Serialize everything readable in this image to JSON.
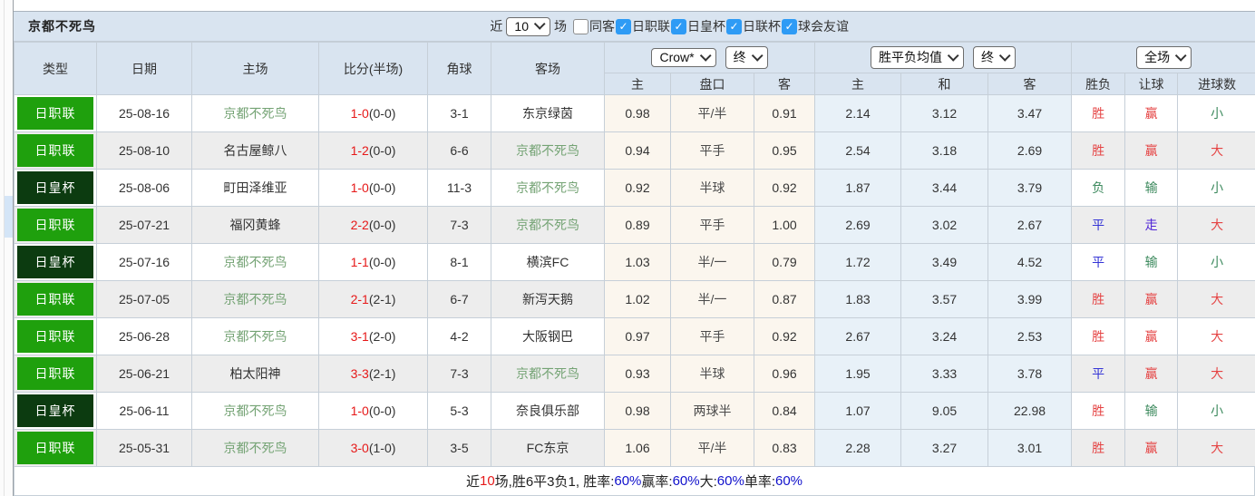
{
  "topbar": {
    "title": "京都不死鸟",
    "recent_label": "近",
    "recent_value": "10",
    "matches_label": "场",
    "filters": [
      {
        "label": "同客",
        "checked": false
      },
      {
        "label": "日职联",
        "checked": true
      },
      {
        "label": "日皇杯",
        "checked": true
      },
      {
        "label": "日联杯",
        "checked": true
      },
      {
        "label": "球会友谊",
        "checked": true
      }
    ]
  },
  "table": {
    "main_headers": [
      "类型",
      "日期",
      "主场",
      "比分(半场)",
      "角球",
      "客场"
    ],
    "odds_group": {
      "company_select": "Crow*",
      "time_select": "终"
    },
    "mean_group": {
      "label_select": "胜平负均值",
      "time_select": "终"
    },
    "scope_group": {
      "scope_select": "全场"
    },
    "sub_headers": [
      "主",
      "盘口",
      "客",
      "主",
      "和",
      "客",
      "胜负",
      "让球",
      "进球数"
    ],
    "rows": [
      {
        "type": "日职联",
        "is_cup": false,
        "date": "25-08-16",
        "home": "京都不死鸟",
        "home_is_focus": true,
        "score_full": "1-0",
        "score_half": "(0-0)",
        "corners": "3-1",
        "away": "东京绿茵",
        "away_is_focus": false,
        "crow_home": "0.98",
        "handicap": "平/半",
        "crow_away": "0.91",
        "mean_home": "2.14",
        "mean_draw": "3.12",
        "mean_away": "3.47",
        "result": "胜",
        "result_color": "red",
        "handicap_result": "赢",
        "handicap_result_color": "red",
        "goals_result": "小",
        "goals_result_color": "green"
      },
      {
        "type": "日职联",
        "is_cup": false,
        "date": "25-08-10",
        "home": "名古屋鲸八",
        "home_is_focus": false,
        "score_full": "1-2",
        "score_half": "(0-0)",
        "corners": "6-6",
        "away": "京都不死鸟",
        "away_is_focus": true,
        "crow_home": "0.94",
        "handicap": "平手",
        "crow_away": "0.95",
        "mean_home": "2.54",
        "mean_draw": "3.18",
        "mean_away": "2.69",
        "result": "胜",
        "result_color": "red",
        "handicap_result": "赢",
        "handicap_result_color": "red",
        "goals_result": "大",
        "goals_result_color": "red"
      },
      {
        "type": "日皇杯",
        "is_cup": true,
        "date": "25-08-06",
        "home": "町田泽维亚",
        "home_is_focus": false,
        "score_full": "1-0",
        "score_half": "(0-0)",
        "corners": "11-3",
        "away": "京都不死鸟",
        "away_is_focus": true,
        "crow_home": "0.92",
        "handicap": "半球",
        "crow_away": "0.92",
        "mean_home": "1.87",
        "mean_draw": "3.44",
        "mean_away": "3.79",
        "result": "负",
        "result_color": "green",
        "handicap_result": "输",
        "handicap_result_color": "green",
        "goals_result": "小",
        "goals_result_color": "green"
      },
      {
        "type": "日职联",
        "is_cup": false,
        "date": "25-07-21",
        "home": "福冈黄蜂",
        "home_is_focus": false,
        "score_full": "2-2",
        "score_half": "(0-0)",
        "corners": "7-3",
        "away": "京都不死鸟",
        "away_is_focus": true,
        "crow_home": "0.89",
        "handicap": "平手",
        "crow_away": "1.00",
        "mean_home": "2.69",
        "mean_draw": "3.02",
        "mean_away": "2.67",
        "result": "平",
        "result_color": "blue",
        "handicap_result": "走",
        "handicap_result_color": "purple",
        "goals_result": "大",
        "goals_result_color": "red"
      },
      {
        "type": "日皇杯",
        "is_cup": true,
        "date": "25-07-16",
        "home": "京都不死鸟",
        "home_is_focus": true,
        "score_full": "1-1",
        "score_half": "(0-0)",
        "corners": "8-1",
        "away": "横滨FC",
        "away_is_focus": false,
        "crow_home": "1.03",
        "handicap": "半/一",
        "crow_away": "0.79",
        "mean_home": "1.72",
        "mean_draw": "3.49",
        "mean_away": "4.52",
        "result": "平",
        "result_color": "blue",
        "handicap_result": "输",
        "handicap_result_color": "green",
        "goals_result": "小",
        "goals_result_color": "green"
      },
      {
        "type": "日职联",
        "is_cup": false,
        "date": "25-07-05",
        "home": "京都不死鸟",
        "home_is_focus": true,
        "score_full": "2-1",
        "score_half": "(2-1)",
        "corners": "6-7",
        "away": "新泻天鹅",
        "away_is_focus": false,
        "crow_home": "1.02",
        "handicap": "半/一",
        "crow_away": "0.87",
        "mean_home": "1.83",
        "mean_draw": "3.57",
        "mean_away": "3.99",
        "result": "胜",
        "result_color": "red",
        "handicap_result": "赢",
        "handicap_result_color": "red",
        "goals_result": "大",
        "goals_result_color": "red"
      },
      {
        "type": "日职联",
        "is_cup": false,
        "date": "25-06-28",
        "home": "京都不死鸟",
        "home_is_focus": true,
        "score_full": "3-1",
        "score_half": "(2-0)",
        "corners": "4-2",
        "away": "大阪钢巴",
        "away_is_focus": false,
        "crow_home": "0.97",
        "handicap": "平手",
        "crow_away": "0.92",
        "mean_home": "2.67",
        "mean_draw": "3.24",
        "mean_away": "2.53",
        "result": "胜",
        "result_color": "red",
        "handicap_result": "赢",
        "handicap_result_color": "red",
        "goals_result": "大",
        "goals_result_color": "red"
      },
      {
        "type": "日职联",
        "is_cup": false,
        "date": "25-06-21",
        "home": "柏太阳神",
        "home_is_focus": false,
        "score_full": "3-3",
        "score_half": "(2-1)",
        "corners": "7-3",
        "away": "京都不死鸟",
        "away_is_focus": true,
        "crow_home": "0.93",
        "handicap": "半球",
        "crow_away": "0.96",
        "mean_home": "1.95",
        "mean_draw": "3.33",
        "mean_away": "3.78",
        "result": "平",
        "result_color": "blue",
        "handicap_result": "赢",
        "handicap_result_color": "red",
        "goals_result": "大",
        "goals_result_color": "red"
      },
      {
        "type": "日皇杯",
        "is_cup": true,
        "date": "25-06-11",
        "home": "京都不死鸟",
        "home_is_focus": true,
        "score_full": "1-0",
        "score_half": "(0-0)",
        "corners": "5-3",
        "away": "奈良俱乐部",
        "away_is_focus": false,
        "crow_home": "0.98",
        "handicap": "两球半",
        "crow_away": "0.84",
        "mean_home": "1.07",
        "mean_draw": "9.05",
        "mean_away": "22.98",
        "result": "胜",
        "result_color": "red",
        "handicap_result": "输",
        "handicap_result_color": "green",
        "goals_result": "小",
        "goals_result_color": "green"
      },
      {
        "type": "日职联",
        "is_cup": false,
        "date": "25-05-31",
        "home": "京都不死鸟",
        "home_is_focus": true,
        "score_full": "3-0",
        "score_half": "(1-0)",
        "corners": "3-5",
        "away": "FC东京",
        "away_is_focus": false,
        "crow_home": "1.06",
        "handicap": "平/半",
        "crow_away": "0.83",
        "mean_home": "2.28",
        "mean_draw": "3.27",
        "mean_away": "3.01",
        "result": "胜",
        "result_color": "red",
        "handicap_result": "赢",
        "handicap_result_color": "red",
        "goals_result": "大",
        "goals_result_color": "red"
      }
    ]
  },
  "footer": {
    "segments": [
      {
        "text": "近",
        "color": "dark"
      },
      {
        "text": "10",
        "color": "red"
      },
      {
        "text": "场,胜6平3负1, 胜率:",
        "color": "dark"
      },
      {
        "text": "60%",
        "color": "blue"
      },
      {
        "text": " 赢率:",
        "color": "dark"
      },
      {
        "text": "60%",
        "color": "blue"
      },
      {
        "text": " 大:",
        "color": "dark"
      },
      {
        "text": "60%",
        "color": "blue"
      },
      {
        "text": " 单率:",
        "color": "dark"
      },
      {
        "text": "60%",
        "color": "blue"
      }
    ]
  },
  "colors": {
    "header_bg": "#d9e4f0",
    "league_badge_green": "#1fa00d",
    "cup_badge_dark": "#0c3b10",
    "team_name_green": "#74a374",
    "score_red": "#e61919",
    "result_red": "#e54444",
    "result_green": "#3d8a5e",
    "result_blue": "#3434d6",
    "result_purple": "#5126d6",
    "percent_blue": "#1111cc",
    "checkbox_blue": "#2e9bf5",
    "crow_cell_bg": "#fbf6ee",
    "mean_cell_bg": "#e8f1f8",
    "alt_row_bg": "#ededed"
  }
}
